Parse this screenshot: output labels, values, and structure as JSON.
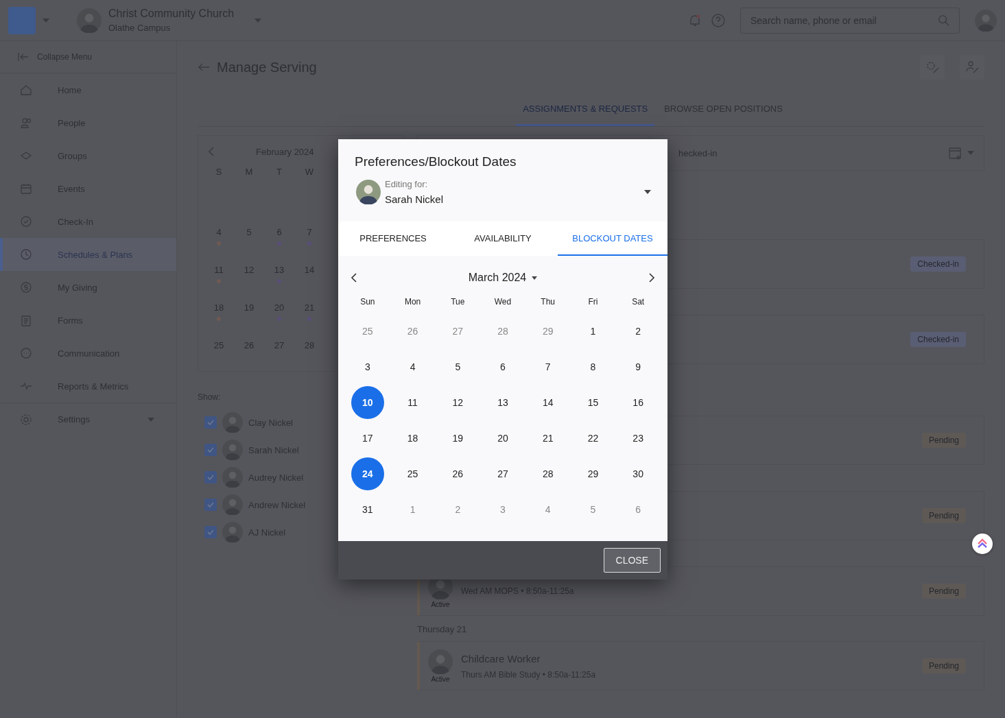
{
  "header": {
    "org_name": "Christ Community Church",
    "campus": "Olathe Campus",
    "search": {
      "placeholder": "Search name, phone or email"
    }
  },
  "sidebar": {
    "collapse_label": "Collapse Menu",
    "items": [
      {
        "label": "Home",
        "selected": false
      },
      {
        "label": "People",
        "selected": false
      },
      {
        "label": "Groups",
        "selected": false
      },
      {
        "label": "Events",
        "selected": false
      },
      {
        "label": "Check-In",
        "selected": false
      },
      {
        "label": "Schedules & Plans",
        "selected": true
      },
      {
        "label": "My Giving",
        "selected": false
      },
      {
        "label": "Forms",
        "selected": false
      },
      {
        "label": "Communication",
        "selected": false
      },
      {
        "label": "Reports & Metrics",
        "selected": false
      },
      {
        "label": "Settings",
        "selected": false,
        "expanded": false
      }
    ]
  },
  "page": {
    "title": "Manage Serving",
    "tabs": [
      {
        "label": "ASSIGNMENTS & REQUESTS",
        "selected": true
      },
      {
        "label": "BROWSE OPEN POSITIONS",
        "selected": false
      }
    ],
    "mini_calendar": {
      "month": "February 2024",
      "weekdays": [
        "S",
        "M",
        "T",
        "W"
      ],
      "weeks": [
        [
          {
            "day": "4",
            "color": "#6e5a52"
          },
          {
            "day": "5"
          },
          {
            "day": "6",
            "color": "#5a4f78"
          },
          {
            "day": "7",
            "color": "#5a4f78"
          }
        ],
        [
          {
            "day": "11",
            "color": "#6e5a52"
          },
          {
            "day": "12"
          },
          {
            "day": "13",
            "color": "#5a4f78"
          },
          {
            "day": "14"
          }
        ],
        [
          {
            "day": "18",
            "color": "#6e5a52"
          },
          {
            "day": "19"
          },
          {
            "day": "20",
            "color": "#5a4f78"
          },
          {
            "day": "21",
            "color": "#5a4f78"
          }
        ],
        [
          {
            "day": "25"
          },
          {
            "day": "26"
          },
          {
            "day": "27"
          },
          {
            "day": "28"
          }
        ]
      ]
    },
    "show_label": "Show:",
    "people": [
      {
        "name": "Clay Nickel",
        "checked": true
      },
      {
        "name": "Sarah Nickel",
        "checked": true
      },
      {
        "name": "Audrey Nickel",
        "checked": true
      },
      {
        "name": "Andrew Nickel",
        "checked": true
      },
      {
        "name": "AJ Nickel",
        "checked": true
      }
    ],
    "filter_label": "hecked-in",
    "list": [
      {
        "kind": "card",
        "status": "Checked-in",
        "color": "#5a5e74"
      },
      {
        "kind": "card",
        "status": "Checked-in",
        "color": "#5a5e74"
      },
      {
        "kind": "card",
        "status": "Pending",
        "color": "#5e5955"
      },
      {
        "kind": "card",
        "status": "Pending",
        "color": "#5e5955"
      },
      {
        "kind": "card",
        "subtitle": "Wed AM MOPS • 8:50a-11:25a",
        "avatar_caption": "Active",
        "status": "Pending",
        "color": "#5e5955"
      },
      {
        "kind": "heading",
        "text": "Thursday 21"
      },
      {
        "kind": "card",
        "title": "Childcare Worker",
        "subtitle": "Thurs AM Bible Study • 8:50a-11:25a",
        "avatar_caption": "Active",
        "status": "Pending",
        "color": "#5e5955"
      }
    ]
  },
  "dialog": {
    "title": "Preferences/Blockout Dates",
    "editing_label": "Editing for:",
    "person": "Sarah Nickel",
    "tabs": [
      {
        "label": "PREFERENCES",
        "selected": false
      },
      {
        "label": "AVAILABILITY",
        "selected": false
      },
      {
        "label": "BLOCKOUT DATES",
        "selected": true
      }
    ],
    "month": "March 2024",
    "weekdays": [
      "Sun",
      "Mon",
      "Tue",
      "Wed",
      "Thu",
      "Fri",
      "Sat"
    ],
    "weeks": [
      [
        {
          "day": "25",
          "outside": true,
          "selected": false
        },
        {
          "day": "26",
          "outside": true,
          "selected": false
        },
        {
          "day": "27",
          "outside": true,
          "selected": false
        },
        {
          "day": "28",
          "outside": true,
          "selected": false
        },
        {
          "day": "29",
          "outside": true,
          "selected": false
        },
        {
          "day": "1",
          "outside": false,
          "selected": false
        },
        {
          "day": "2",
          "outside": false,
          "selected": false
        }
      ],
      [
        {
          "day": "3",
          "outside": false,
          "selected": false
        },
        {
          "day": "4",
          "outside": false,
          "selected": false
        },
        {
          "day": "5",
          "outside": false,
          "selected": false
        },
        {
          "day": "6",
          "outside": false,
          "selected": false
        },
        {
          "day": "7",
          "outside": false,
          "selected": false
        },
        {
          "day": "8",
          "outside": false,
          "selected": false
        },
        {
          "day": "9",
          "outside": false,
          "selected": false
        }
      ],
      [
        {
          "day": "10",
          "outside": false,
          "selected": true
        },
        {
          "day": "11",
          "outside": false,
          "selected": false
        },
        {
          "day": "12",
          "outside": false,
          "selected": false
        },
        {
          "day": "13",
          "outside": false,
          "selected": false
        },
        {
          "day": "14",
          "outside": false,
          "selected": false
        },
        {
          "day": "15",
          "outside": false,
          "selected": false
        },
        {
          "day": "16",
          "outside": false,
          "selected": false
        }
      ],
      [
        {
          "day": "17",
          "outside": false,
          "selected": false
        },
        {
          "day": "18",
          "outside": false,
          "selected": false
        },
        {
          "day": "19",
          "outside": false,
          "selected": false
        },
        {
          "day": "20",
          "outside": false,
          "selected": false
        },
        {
          "day": "21",
          "outside": false,
          "selected": false
        },
        {
          "day": "22",
          "outside": false,
          "selected": false
        },
        {
          "day": "23",
          "outside": false,
          "selected": false
        }
      ],
      [
        {
          "day": "24",
          "outside": false,
          "selected": true
        },
        {
          "day": "25",
          "outside": false,
          "selected": false
        },
        {
          "day": "26",
          "outside": false,
          "selected": false
        },
        {
          "day": "27",
          "outside": false,
          "selected": false
        },
        {
          "day": "28",
          "outside": false,
          "selected": false
        },
        {
          "day": "29",
          "outside": false,
          "selected": false
        },
        {
          "day": "30",
          "outside": false,
          "selected": false
        }
      ],
      [
        {
          "day": "31",
          "outside": false,
          "selected": false
        },
        {
          "day": "1",
          "outside": true,
          "selected": false
        },
        {
          "day": "2",
          "outside": true,
          "selected": false
        },
        {
          "day": "3",
          "outside": true,
          "selected": false
        },
        {
          "day": "4",
          "outside": true,
          "selected": false
        },
        {
          "day": "5",
          "outside": true,
          "selected": false
        },
        {
          "day": "6",
          "outside": true,
          "selected": false
        }
      ]
    ],
    "close_label": "CLOSE"
  }
}
